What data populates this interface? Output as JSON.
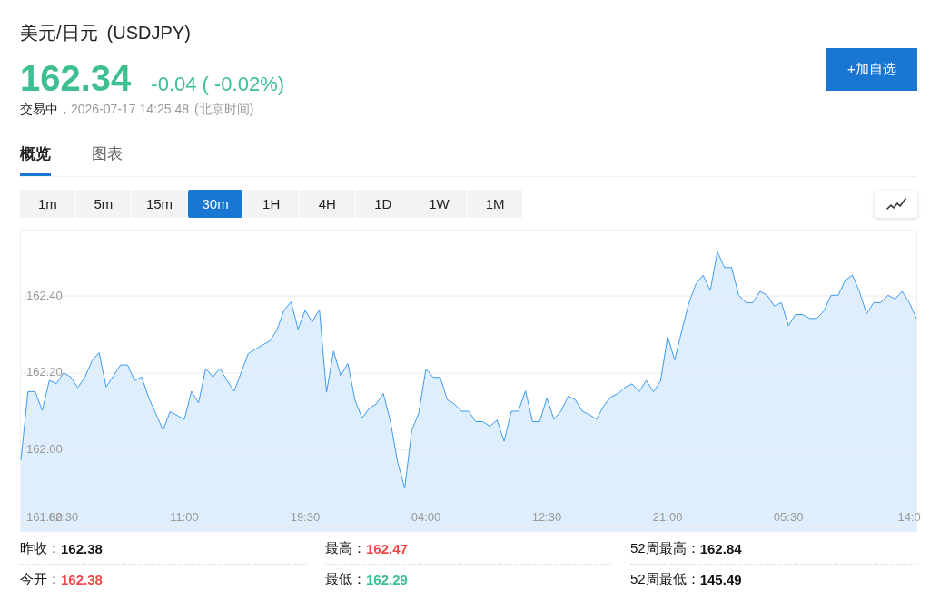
{
  "instrument": {
    "name": "美元/日元",
    "symbol": "(USDJPY)"
  },
  "quote": {
    "price": "162.34",
    "change": "-0.04 ( -0.02%)",
    "color": "#3dbf8f"
  },
  "session": {
    "status": "交易中，",
    "time": "2026-07-17 14:25:48",
    "timezone": "(北京时间)"
  },
  "watchlist_button": {
    "label": "+加自选"
  },
  "tabs": [
    {
      "label": "概览",
      "selected": true
    },
    {
      "label": "图表",
      "selected": false
    }
  ],
  "timeframes": [
    {
      "label": "1m",
      "selected": false
    },
    {
      "label": "5m",
      "selected": false
    },
    {
      "label": "15m",
      "selected": false
    },
    {
      "label": "30m",
      "selected": true
    },
    {
      "label": "1H",
      "selected": false
    },
    {
      "label": "4H",
      "selected": false
    },
    {
      "label": "1D",
      "selected": false
    },
    {
      "label": "1W",
      "selected": false
    },
    {
      "label": "1M",
      "selected": false
    }
  ],
  "chart": {
    "chart_data": {
      "type": "area",
      "categories": [
        null,
        null,
        null,
        null,
        null,
        null,
        "02:30",
        null,
        null,
        null,
        null,
        null,
        null,
        null,
        null,
        null,
        null,
        null,
        null,
        null,
        null,
        null,
        null,
        "11:00",
        null,
        null,
        null,
        null,
        null,
        null,
        null,
        null,
        null,
        null,
        null,
        null,
        null,
        null,
        null,
        null,
        "19:30",
        null,
        null,
        null,
        null,
        null,
        null,
        null,
        null,
        null,
        null,
        null,
        null,
        null,
        null,
        null,
        null,
        "04:00",
        null,
        null,
        null,
        null,
        null,
        null,
        null,
        null,
        null,
        null,
        null,
        null,
        null,
        null,
        null,
        null,
        "12:30",
        null,
        null,
        null,
        null,
        null,
        null,
        null,
        null,
        null,
        null,
        null,
        null,
        null,
        null,
        null,
        null,
        "21:00",
        null,
        null,
        null,
        null,
        null,
        null,
        null,
        null,
        null,
        null,
        null,
        null,
        null,
        null,
        null,
        null,
        "05:30",
        null,
        null,
        null,
        null,
        null,
        null,
        null,
        null,
        null,
        null,
        null,
        null,
        null,
        null,
        null,
        null,
        "14:0",
        null
      ],
      "series": [
        {
          "color": "#3d9bf2",
          "values": [
            161.974,
            162.152,
            162.152,
            162.103,
            162.181,
            162.173,
            162.201,
            162.19,
            162.162,
            162.189,
            162.232,
            162.253,
            162.164,
            162.192,
            162.221,
            162.221,
            162.181,
            162.19,
            162.135,
            162.094,
            162.052,
            162.1,
            162.09,
            162.08,
            162.153,
            162.123,
            162.212,
            162.19,
            162.212,
            162.181,
            162.153,
            162.202,
            162.251,
            162.262,
            162.273,
            162.283,
            162.311,
            162.362,
            162.385,
            162.314,
            162.363,
            162.333,
            162.365,
            162.15,
            162.257,
            162.193,
            162.225,
            162.131,
            162.083,
            162.108,
            162.12,
            162.147,
            162.074,
            161.97,
            161.901,
            162.051,
            162.097,
            162.211,
            162.189,
            162.189,
            162.131,
            162.12,
            162.101,
            162.101,
            162.074,
            162.074,
            162.062,
            162.078,
            162.023,
            162.101,
            162.101,
            162.154,
            162.074,
            162.074,
            162.136,
            162.08,
            162.101,
            162.14,
            162.131,
            162.101,
            162.092,
            162.08,
            162.115,
            162.138,
            162.146,
            162.163,
            162.172,
            162.152,
            162.181,
            162.152,
            162.179,
            162.294,
            162.234,
            162.311,
            162.383,
            162.432,
            162.454,
            162.414,
            162.515,
            162.474,
            162.474,
            162.402,
            162.383,
            162.383,
            162.412,
            162.402,
            162.374,
            162.383,
            162.323,
            162.352,
            162.352,
            162.342,
            162.342,
            162.362,
            162.402,
            162.402,
            162.441,
            162.454,
            162.411,
            162.354,
            162.383,
            162.383,
            162.402,
            162.392,
            162.412,
            162.383,
            162.342
          ]
        }
      ],
      "ylim": [
        161.79,
        162.57
      ],
      "yticks": [
        {
          "value": 161.8,
          "label": "161.80"
        },
        {
          "value": 162.0,
          "label": "162.00"
        },
        {
          "value": 162.2,
          "label": "162.20"
        },
        {
          "value": 162.4,
          "label": "162.40"
        }
      ],
      "grid": true
    }
  },
  "stats": [
    {
      "label": "昨收：",
      "value": "162.38",
      "color": "#111111"
    },
    {
      "label": "最高：",
      "value": "162.47",
      "color": "#f04848"
    },
    {
      "label": "52周最高：",
      "value": "162.84",
      "color": "#111111"
    },
    {
      "label": "今开：",
      "value": "162.38",
      "color": "#f04848"
    },
    {
      "label": "最低：",
      "value": "162.29",
      "color": "#3dbf8f"
    },
    {
      "label": "52周最低：",
      "value": "145.49",
      "color": "#111111"
    }
  ]
}
